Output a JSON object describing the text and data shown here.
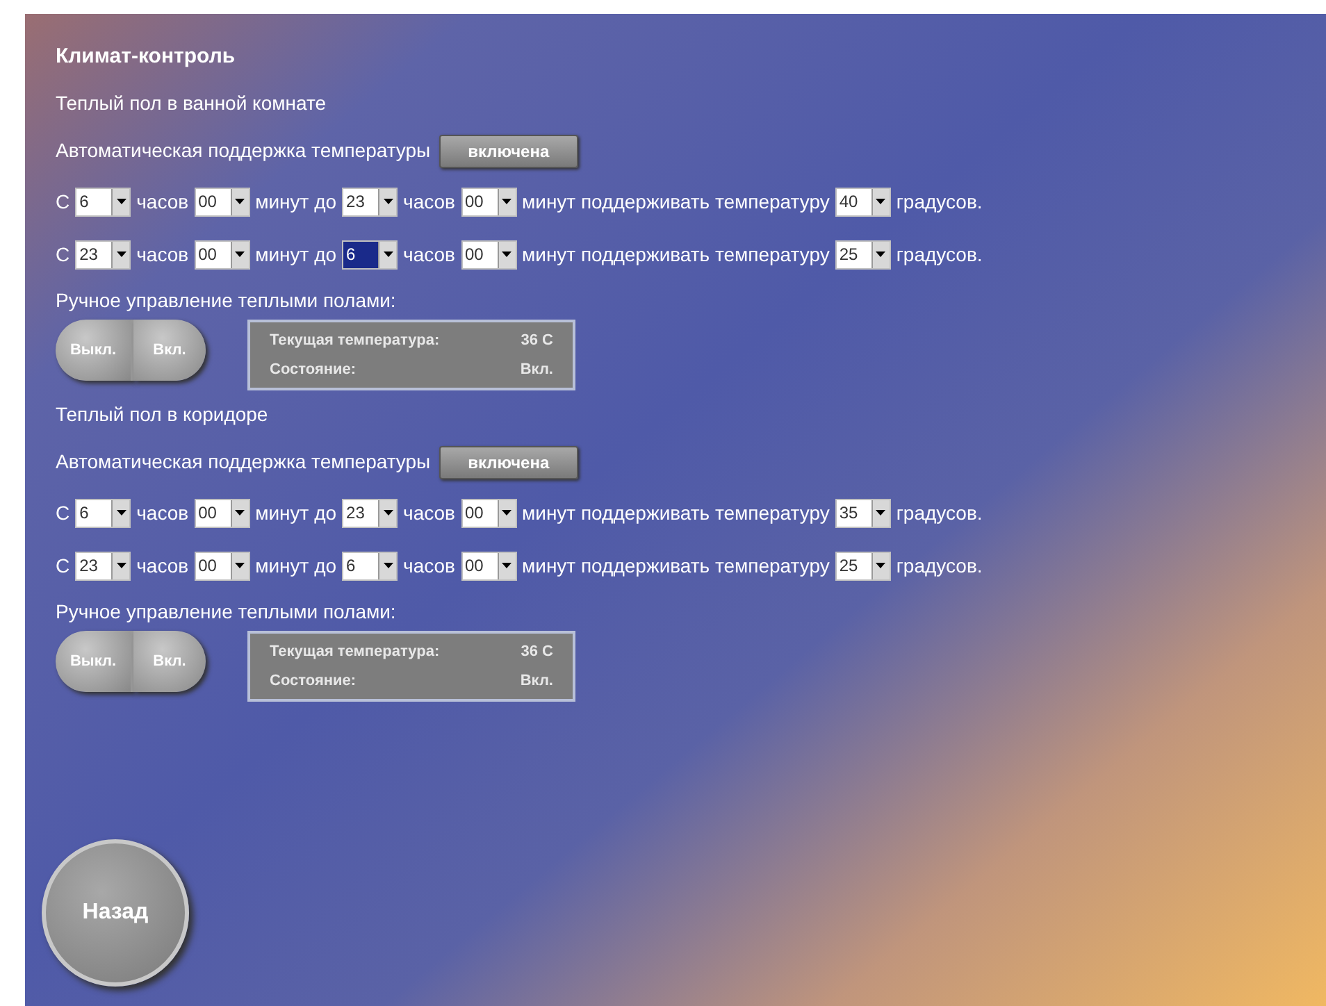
{
  "title": "Климат-контроль",
  "zones": [
    {
      "name": "Теплый пол в ванной комнате",
      "auto_label": "Автоматическая поддержка температуры",
      "auto_button": "включена",
      "schedules": [
        [
          {
            "kind": "text",
            "text": "С"
          },
          {
            "kind": "select",
            "value": "6",
            "focused": false
          },
          {
            "kind": "text",
            "text": "часов"
          },
          {
            "kind": "select",
            "value": "00",
            "focused": false
          },
          {
            "kind": "text",
            "text": "минут до"
          },
          {
            "kind": "select",
            "value": "23",
            "focused": false
          },
          {
            "kind": "text",
            "text": "часов"
          },
          {
            "kind": "select",
            "value": "00",
            "focused": false
          },
          {
            "kind": "text",
            "text": "минут поддерживать температуру"
          },
          {
            "kind": "select",
            "value": "40",
            "focused": false
          },
          {
            "kind": "text",
            "text": "градусов."
          }
        ],
        [
          {
            "kind": "text",
            "text": "С"
          },
          {
            "kind": "select",
            "value": "23",
            "focused": false
          },
          {
            "kind": "text",
            "text": "часов"
          },
          {
            "kind": "select",
            "value": "00",
            "focused": false
          },
          {
            "kind": "text",
            "text": "минут до"
          },
          {
            "kind": "select",
            "value": "6",
            "focused": true
          },
          {
            "kind": "text",
            "text": "часов"
          },
          {
            "kind": "select",
            "value": "00",
            "focused": false
          },
          {
            "kind": "text",
            "text": "минут поддерживать температуру"
          },
          {
            "kind": "select",
            "value": "25",
            "focused": false
          },
          {
            "kind": "text",
            "text": "градусов."
          }
        ]
      ],
      "manual_label": "Ручное управление теплыми полами:",
      "off_button": "Выкл.",
      "on_button": "Вкл.",
      "status": [
        {
          "label": "Текущая температура:",
          "value": "36 C"
        },
        {
          "label": "Состояние:",
          "value": "Вкл."
        }
      ]
    },
    {
      "name": "Теплый пол в коридоре",
      "auto_label": "Автоматическая поддержка температуры",
      "auto_button": "включена",
      "schedules": [
        [
          {
            "kind": "text",
            "text": "С"
          },
          {
            "kind": "select",
            "value": "6",
            "focused": false
          },
          {
            "kind": "text",
            "text": "часов"
          },
          {
            "kind": "select",
            "value": "00",
            "focused": false
          },
          {
            "kind": "text",
            "text": "минут до"
          },
          {
            "kind": "select",
            "value": "23",
            "focused": false
          },
          {
            "kind": "text",
            "text": "часов"
          },
          {
            "kind": "select",
            "value": "00",
            "focused": false
          },
          {
            "kind": "text",
            "text": "минут поддерживать температуру"
          },
          {
            "kind": "select",
            "value": "35",
            "focused": false
          },
          {
            "kind": "text",
            "text": "градусов."
          }
        ],
        [
          {
            "kind": "text",
            "text": "С"
          },
          {
            "kind": "select",
            "value": "23",
            "focused": false
          },
          {
            "kind": "text",
            "text": "часов"
          },
          {
            "kind": "select",
            "value": "00",
            "focused": false
          },
          {
            "kind": "text",
            "text": "минут до"
          },
          {
            "kind": "select",
            "value": "6",
            "focused": false
          },
          {
            "kind": "text",
            "text": "часов"
          },
          {
            "kind": "select",
            "value": "00",
            "focused": false
          },
          {
            "kind": "text",
            "text": "минут поддерживать температуру"
          },
          {
            "kind": "select",
            "value": "25",
            "focused": false
          },
          {
            "kind": "text",
            "text": "градусов."
          }
        ]
      ],
      "manual_label": "Ручное управление теплыми полами:",
      "off_button": "Выкл.",
      "on_button": "Вкл.",
      "status": [
        {
          "label": "Текущая температура:",
          "value": "36 C"
        },
        {
          "label": "Состояние:",
          "value": "Вкл."
        }
      ]
    }
  ],
  "back_button": "Назад"
}
